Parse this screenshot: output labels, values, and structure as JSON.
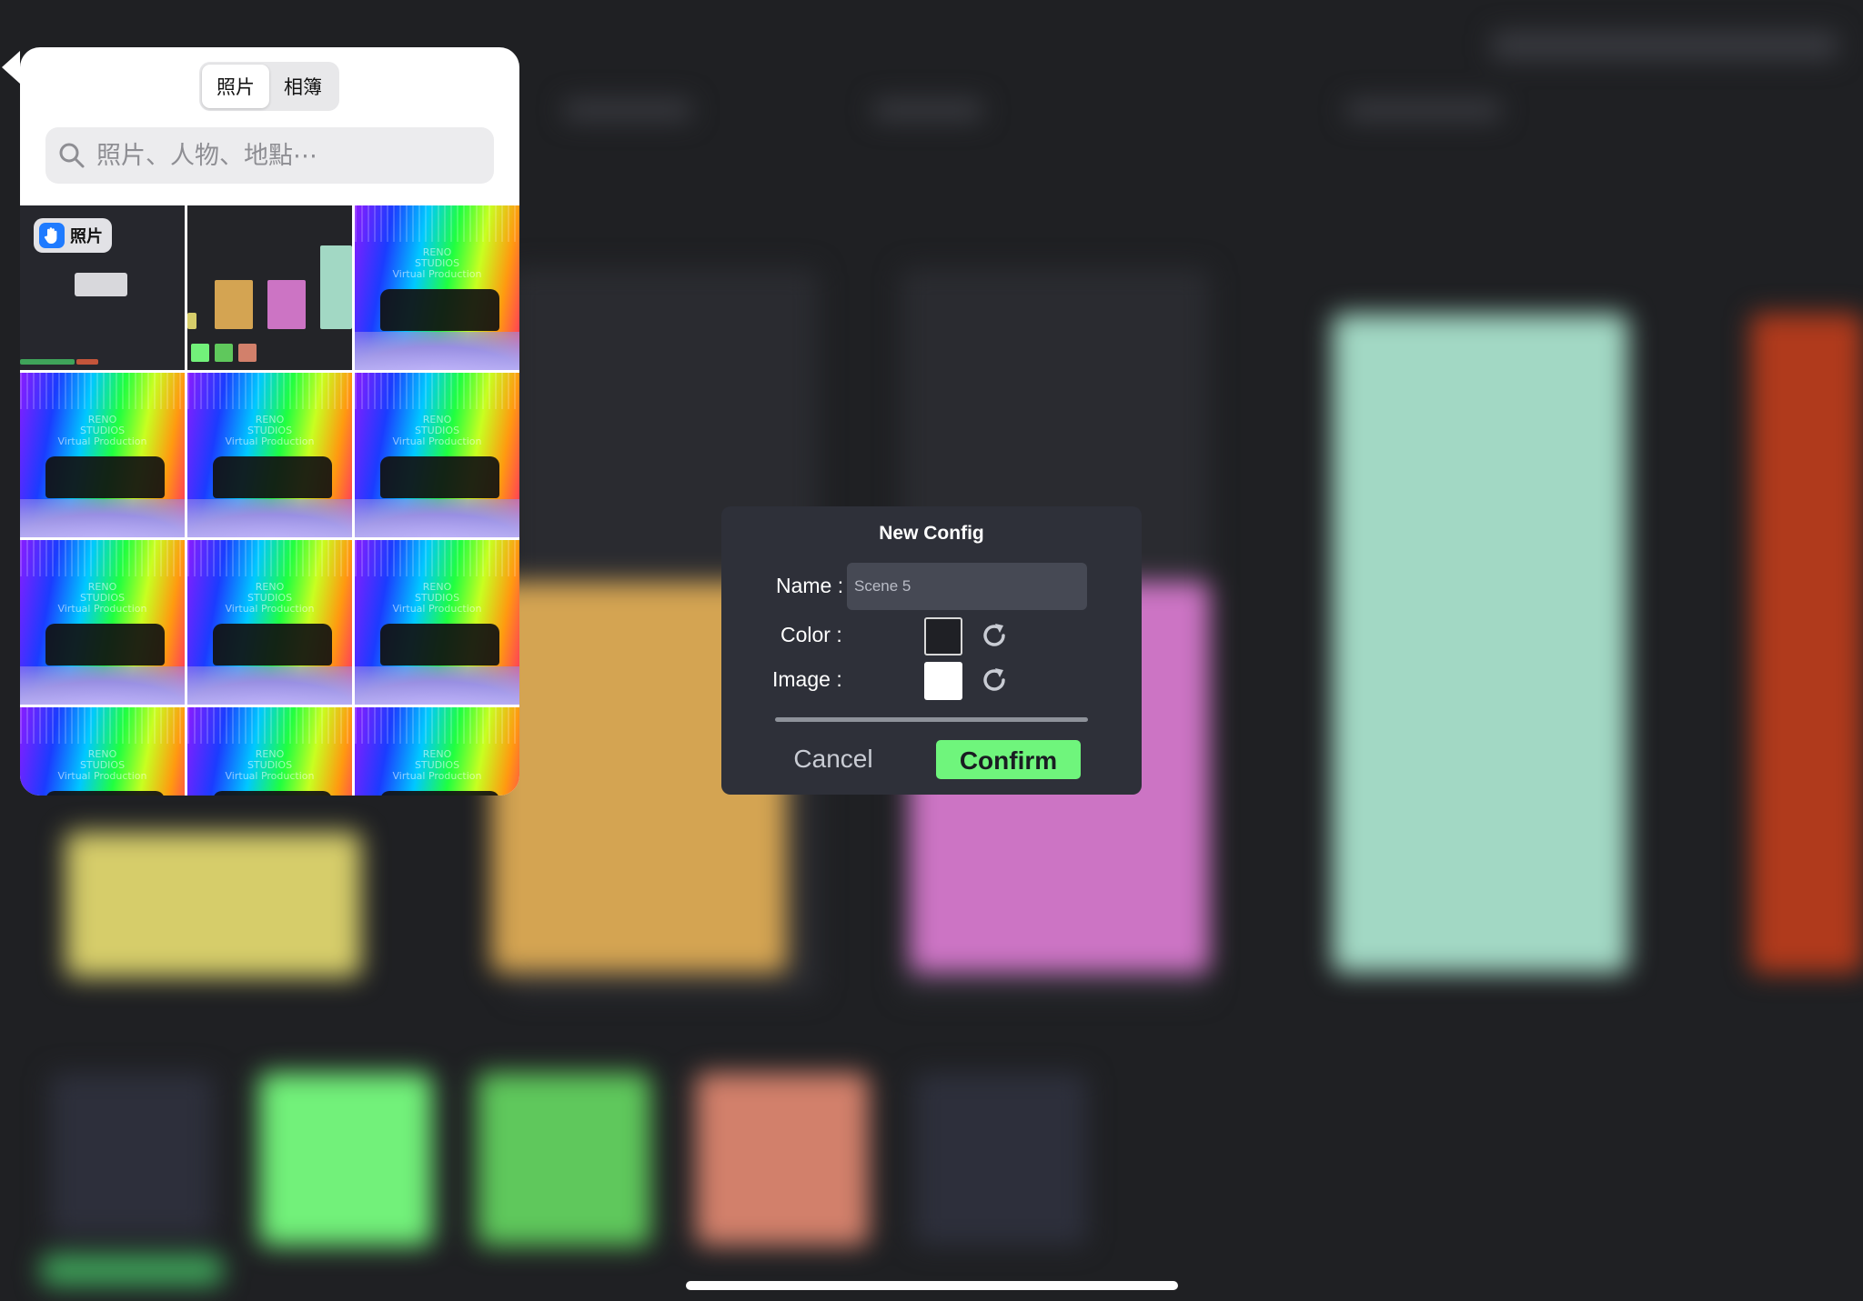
{
  "photo_picker": {
    "tabs": [
      {
        "label": "照片",
        "active": true
      },
      {
        "label": "相簿",
        "active": false
      }
    ],
    "search": {
      "placeholder": "照片、人物、地點⋯",
      "value": ""
    },
    "photo_badge": "照片",
    "studio_caption": "RENO\nSTUDIOS\nVirtual Production",
    "thumbnails": [
      {
        "kind": "screenshot-dialog"
      },
      {
        "kind": "screenshot-ui"
      },
      {
        "kind": "studio-photo"
      },
      {
        "kind": "studio-photo"
      },
      {
        "kind": "studio-photo"
      },
      {
        "kind": "studio-photo"
      },
      {
        "kind": "studio-photo"
      },
      {
        "kind": "studio-photo"
      },
      {
        "kind": "studio-photo"
      },
      {
        "kind": "studio-photo"
      },
      {
        "kind": "studio-photo"
      },
      {
        "kind": "studio-photo"
      }
    ]
  },
  "dialog": {
    "title": "New Config",
    "name_label": "Name :",
    "name_value": "Scene 5",
    "color_label": "Color :",
    "image_label": "Image :",
    "color_value": "#1f2025",
    "image_value": "#ffffff",
    "cancel_label": "Cancel",
    "confirm_label": "Confirm"
  },
  "background_colors": {
    "yellow": "#d6cd6a",
    "orange": "#d4a452",
    "pink": "#cc74c4",
    "mint": "#a2d8c4",
    "red": "#b03a1c",
    "green_bright": "#72f17a",
    "green": "#5fc85c",
    "salmon": "#d2806b"
  }
}
